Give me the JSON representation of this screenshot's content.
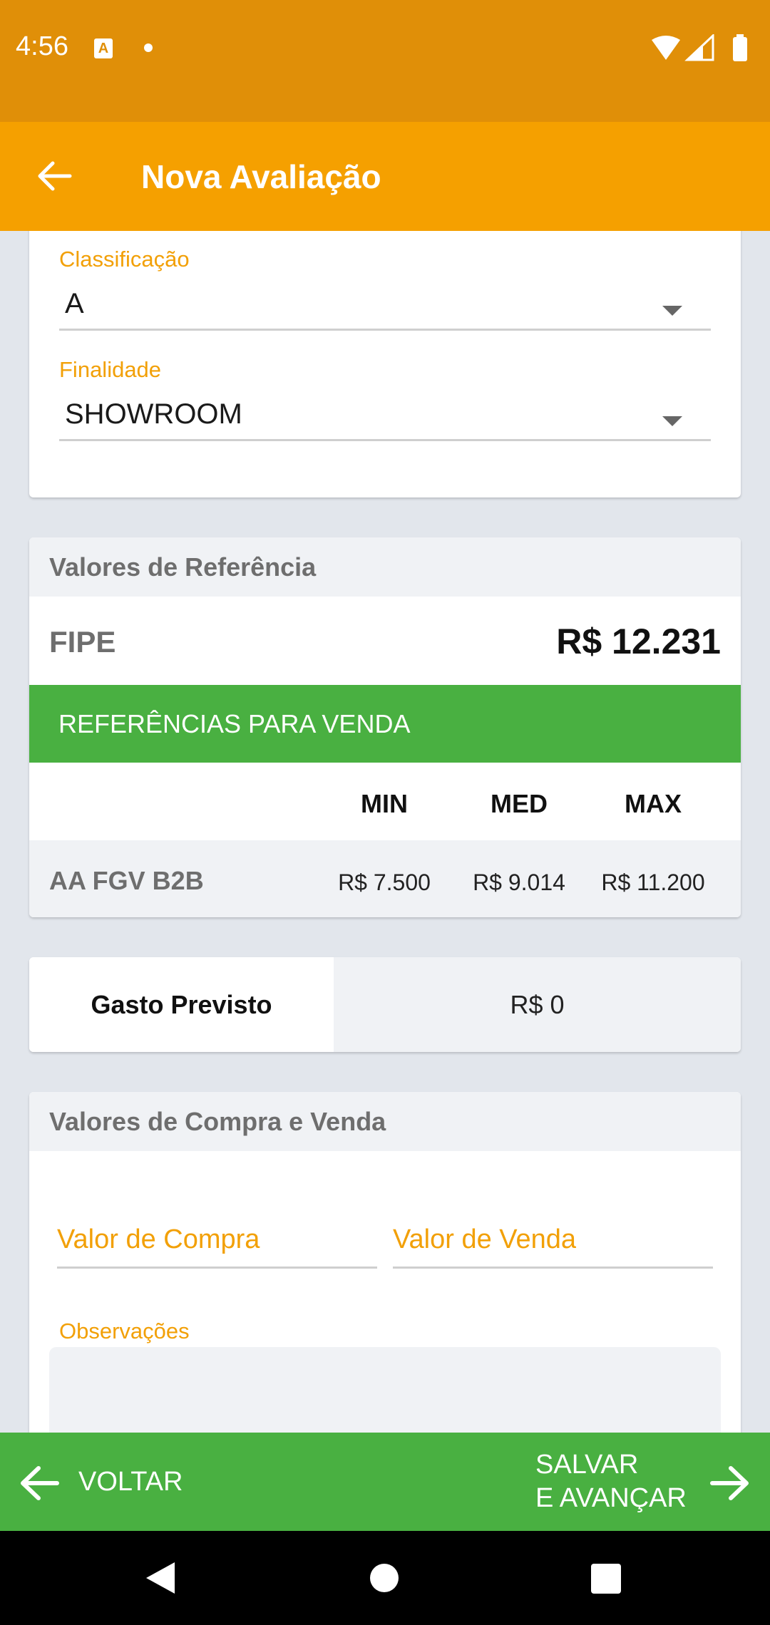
{
  "status_bar": {
    "time": "4:56",
    "notification_icon_letter": "A"
  },
  "app_bar": {
    "title": "Nova Avaliação"
  },
  "classificacao": {
    "label": "Classificação",
    "value": "A"
  },
  "finalidade": {
    "label": "Finalidade",
    "value": "SHOWROOM"
  },
  "referencia": {
    "header": "Valores de Referência",
    "fipe_label": "FIPE",
    "fipe_value": "R$  12.231",
    "vendas_title": "REFERÊNCIAS PARA VENDA",
    "columns": [
      "MIN",
      "MED",
      "MAX"
    ],
    "rows": [
      {
        "label": "AA FGV B2B",
        "min": "R$  7.500",
        "med": "R$  9.014",
        "max": "R$  11.200"
      }
    ]
  },
  "gasto": {
    "label": "Gasto Previsto",
    "value": "R$  0"
  },
  "compra_venda": {
    "header": "Valores de Compra e Venda",
    "compra_placeholder": "Valor de Compra",
    "venda_placeholder": "Valor de Venda",
    "observacoes_label": "Observações"
  },
  "bottom_bar": {
    "voltar": "VOLTAR",
    "salvar_line1": "SALVAR",
    "salvar_line2": "E AVANÇAR"
  },
  "colors": {
    "status_bar": "#e08f08",
    "app_bar": "#f5a000",
    "accent_green": "#49b041",
    "label_orange": "#f2a007"
  }
}
